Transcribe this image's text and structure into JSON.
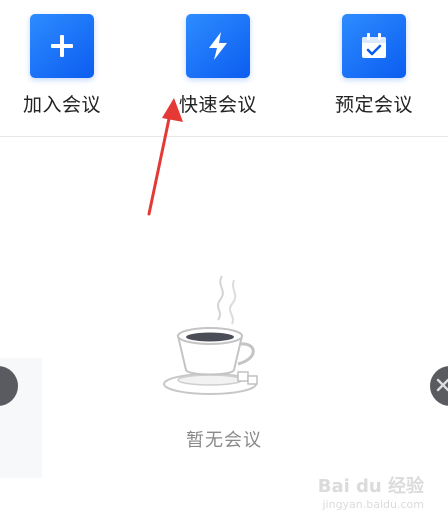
{
  "actions": [
    {
      "label": "加入会议",
      "icon": "plus-icon"
    },
    {
      "label": "快速会议",
      "icon": "lightning-icon"
    },
    {
      "label": "预定会议",
      "icon": "calendar-check-icon"
    }
  ],
  "empty_state": {
    "icon": "coffee-cup-icon",
    "text": "暂无会议"
  },
  "annotation": {
    "arrow": "red-arrow-icon"
  },
  "watermark": {
    "text": "Bai du 经验",
    "sub": "jingyan.baidu.com"
  },
  "colors": {
    "accent": "#0b5df0",
    "arrow": "#e53935",
    "muted_text": "#8a8a8a"
  }
}
